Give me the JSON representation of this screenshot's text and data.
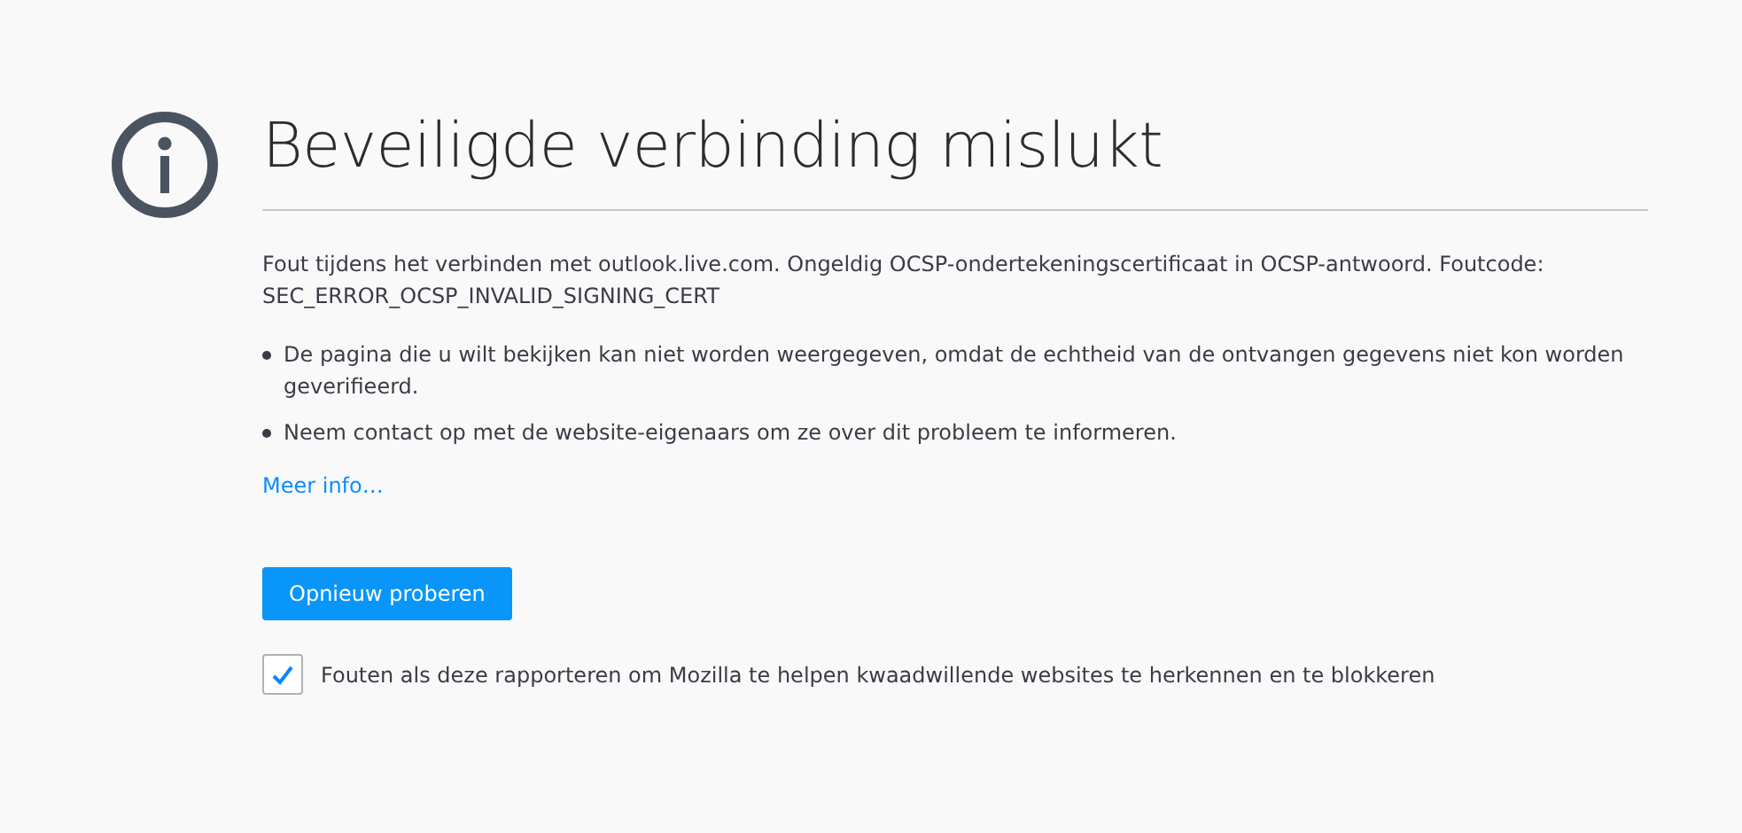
{
  "title": "Beveiligde verbinding mislukt",
  "error_message": "Fout tijdens het verbinden met outlook.live.com. Ongeldig OCSP-ondertekeningscertificaat in OCSP-antwoord. Foutcode: SEC_ERROR_OCSP_INVALID_SIGNING_CERT",
  "bullets": [
    "De pagina die u wilt bekijken kan niet worden weergegeven, omdat de echtheid van de ontvangen gegevens niet kon worden geverifieerd.",
    "Neem contact op met de website-eigenaars om ze over dit probleem te informeren."
  ],
  "more_info_link": "Meer info…",
  "retry_button": "Opnieuw proberen",
  "report_checkbox": {
    "label": "Fouten als deze rapporteren om Mozilla te helpen kwaadwillende websites te herkennen en te blokkeren",
    "checked": true
  }
}
